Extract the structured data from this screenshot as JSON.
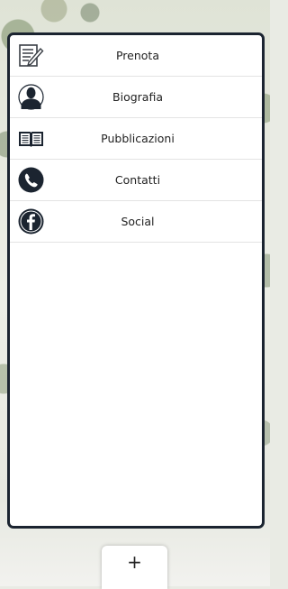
{
  "menu": {
    "items": [
      {
        "label": "Prenota",
        "icon": "booking-form-icon"
      },
      {
        "label": "Biografia",
        "icon": "person-icon"
      },
      {
        "label": "Pubblicazioni",
        "icon": "open-book-icon"
      },
      {
        "label": "Contatti",
        "icon": "phone-icon"
      },
      {
        "label": "Social",
        "icon": "facebook-icon"
      }
    ]
  },
  "fab": {
    "label": "+"
  },
  "colors": {
    "card_border": "#1b2430",
    "icon_dark": "#1b2430",
    "divider": "#e3e3e3"
  }
}
